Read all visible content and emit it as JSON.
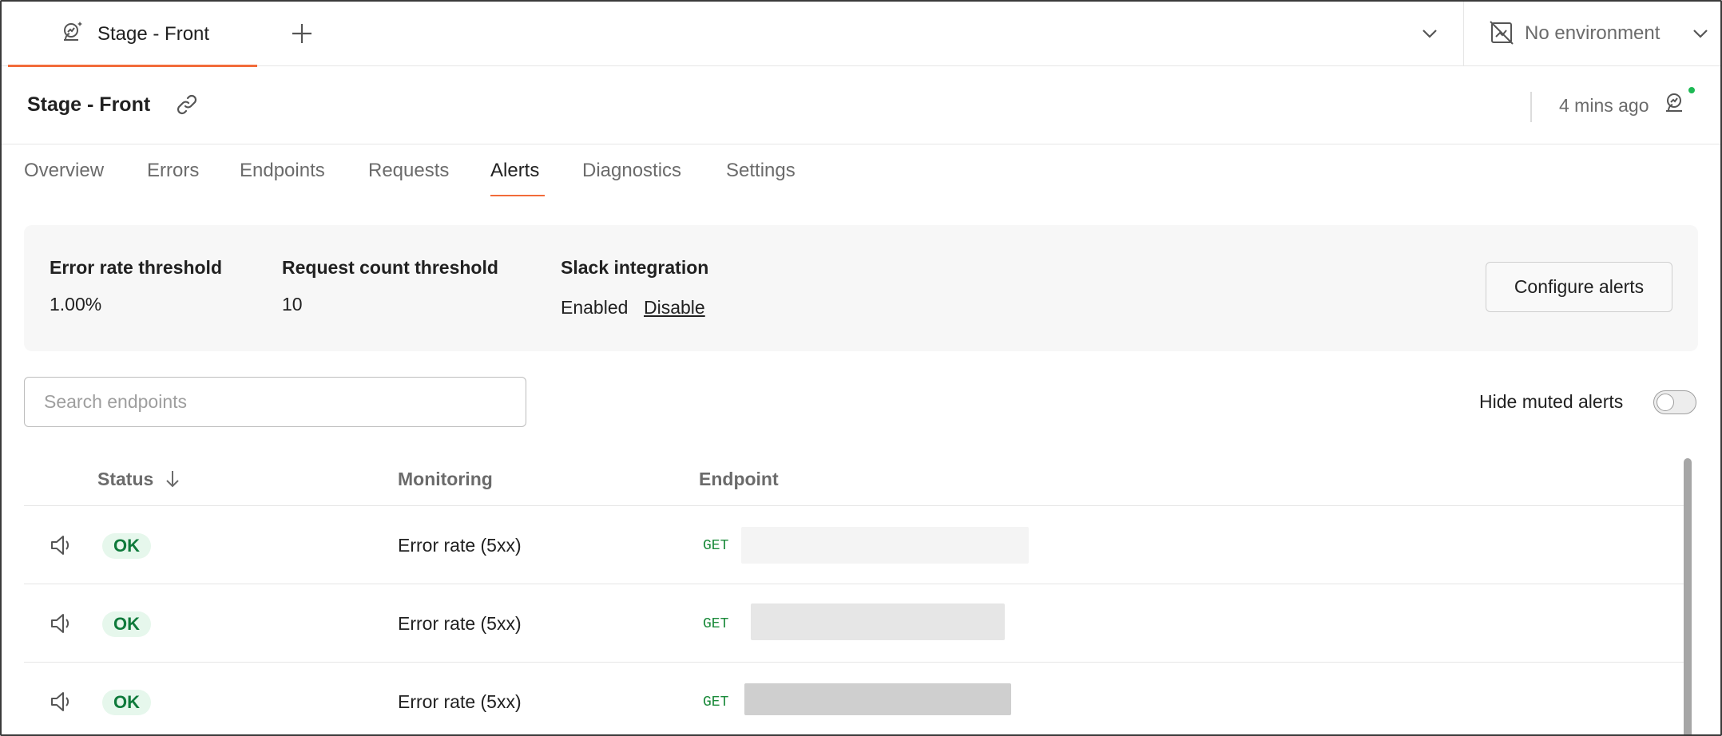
{
  "tabbar": {
    "tab_label": "Stage - Front",
    "new_tab_icon": "plus-icon",
    "environment_label": "No environment"
  },
  "header": {
    "title": "Stage - Front",
    "updated": "4 mins ago",
    "status_color": "#1db954"
  },
  "nav": {
    "items": [
      "Overview",
      "Errors",
      "Endpoints",
      "Requests",
      "Alerts",
      "Diagnostics",
      "Settings"
    ],
    "active": "Alerts"
  },
  "summary": {
    "error_rate": {
      "label": "Error rate threshold",
      "value": "1.00%"
    },
    "request_count": {
      "label": "Request count threshold",
      "value": "10"
    },
    "slack": {
      "label": "Slack integration",
      "value": "Enabled",
      "action": "Disable"
    },
    "configure_label": "Configure alerts"
  },
  "search": {
    "placeholder": "Search endpoints",
    "value": ""
  },
  "toggle": {
    "label": "Hide muted alerts",
    "on": false
  },
  "table": {
    "columns": {
      "status": "Status",
      "monitoring": "Monitoring",
      "endpoint": "Endpoint"
    },
    "sort": {
      "column": "Status",
      "direction": "descending"
    },
    "rows": [
      {
        "status": "OK",
        "monitoring": "Error rate (5xx)",
        "method": "GET"
      },
      {
        "status": "OK",
        "monitoring": "Error rate (5xx)",
        "method": "GET"
      },
      {
        "status": "OK",
        "monitoring": "Error rate (5xx)",
        "method": "GET"
      }
    ]
  },
  "colors": {
    "accent": "#f26b3a",
    "ok_badge_bg": "#e6f7ec",
    "ok_badge_text": "#0f7a3b",
    "method_get": "#1a8a3a"
  }
}
